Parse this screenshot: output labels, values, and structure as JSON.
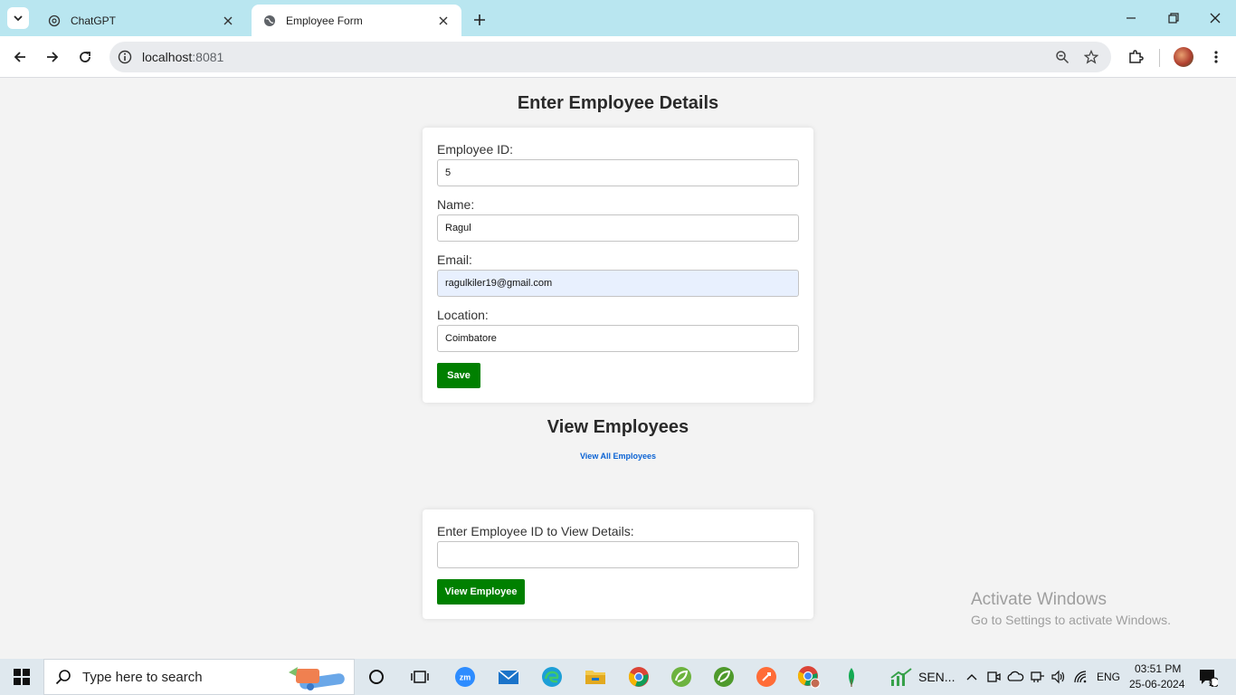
{
  "browser": {
    "tabs": [
      {
        "title": "ChatGPT",
        "active": false
      },
      {
        "title": "Employee Form",
        "active": true
      }
    ],
    "url_host": "localhost",
    "url_port": ":8081"
  },
  "form": {
    "heading": "Enter Employee Details",
    "fields": [
      {
        "label": "Employee ID:",
        "value": "5"
      },
      {
        "label": "Name:",
        "value": "Ragul"
      },
      {
        "label": "Email:",
        "value": "ragulkiler19@gmail.com"
      },
      {
        "label": "Location:",
        "value": "Coimbatore"
      }
    ],
    "save_label": "Save"
  },
  "view": {
    "heading": "View Employees",
    "link_text": "View All Employees",
    "lookup_label": "Enter Employee ID to View Details:",
    "lookup_value": "",
    "button_label": "View Employee"
  },
  "watermark": {
    "title": "Activate Windows",
    "subtitle": "Go to Settings to activate Windows."
  },
  "taskbar": {
    "search_placeholder": "Type here to search",
    "app_label": "SEN...",
    "language": "ENG",
    "time": "03:51 PM",
    "date": "25-06-2024",
    "notification_count": "1"
  },
  "colors": {
    "tabstrip": "#b9e6f0",
    "accent_green": "#008000",
    "link_blue": "#0b63d4",
    "page_bg": "#f3f3f3"
  }
}
